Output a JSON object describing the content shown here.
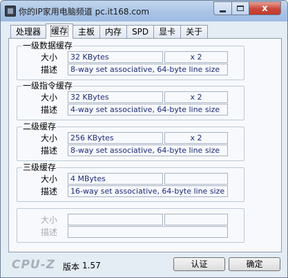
{
  "window": {
    "title": "你的IP家用电脑频道 pc.it168.com",
    "close_glyph": "x"
  },
  "tabs": [
    {
      "label": "处理器",
      "active": false
    },
    {
      "label": "缓存",
      "active": true
    },
    {
      "label": "主板",
      "active": false
    },
    {
      "label": "内存",
      "active": false
    },
    {
      "label": "SPD",
      "active": false
    },
    {
      "label": "显卡",
      "active": false
    },
    {
      "label": "关于",
      "active": false
    }
  ],
  "labels": {
    "size": "大小",
    "descriptor": "描述"
  },
  "groups": [
    {
      "title": "一级数据缓存",
      "size": "32 KBytes",
      "count": "x 2",
      "descriptor": "8-way set associative, 64-byte line size"
    },
    {
      "title": "一级指令缓存",
      "size": "32 KBytes",
      "count": "x 2",
      "descriptor": "4-way set associative, 64-byte line size"
    },
    {
      "title": "二级缓存",
      "size": "256 KBytes",
      "count": "x 2",
      "descriptor": "8-way set associative, 64-byte line size"
    },
    {
      "title": "三级缓存",
      "size": "4 MBytes",
      "count": "",
      "descriptor": "16-way set associative, 64-byte line size"
    },
    {
      "title": "",
      "size": "",
      "count": "",
      "descriptor": ""
    }
  ],
  "footer": {
    "logo": "CPU-Z",
    "version_label": "版本",
    "version": "1.57",
    "validate_button": "认证",
    "ok_button": "确定"
  }
}
